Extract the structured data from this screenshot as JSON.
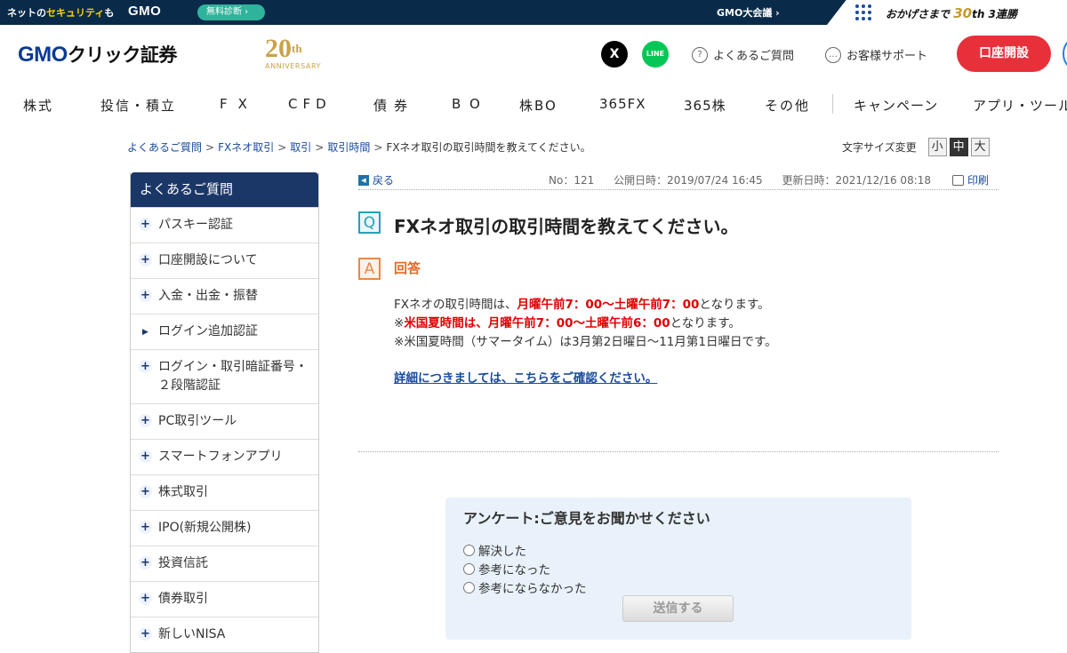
{
  "topbar": {
    "lead": "ネットの",
    "lead_highlight": "セキュリティ",
    "lead_tail": "も",
    "brand": "GMO",
    "diagnosis": "無料診断",
    "summit": "GMO大会議",
    "tagline_pre": "おかげさまで",
    "tagline_num": "30",
    "tagline_post": "th 3連勝"
  },
  "header": {
    "logo_en": "GMO",
    "logo_jp": "クリック証券",
    "anniv_num": "20",
    "anniv_sup": "th",
    "anniv_text": "ANNIVERSARY",
    "x_label": "X",
    "line_label": "LINE",
    "faq": "よくあるご質問",
    "support": "お客様サポート",
    "open_account": "口座開設"
  },
  "nav": [
    "株式",
    "投信・積立",
    "FX",
    "CFD",
    "債券",
    "BO",
    "株BO",
    "365FX",
    "365株",
    "その他",
    "キャンペーン",
    "アプリ・ツール"
  ],
  "breadcrumb": [
    "よくあるご質問",
    "FXネオ取引",
    "取引",
    "取引時間",
    "FXネオ取引の取引時間を教えてください。"
  ],
  "fontsize": {
    "label": "文字サイズ変更",
    "small": "小",
    "medium": "中",
    "large": "大",
    "selected": "中"
  },
  "sidebar": {
    "title": "よくあるご質問",
    "items": [
      {
        "label": "パスキー認証",
        "type": "plus"
      },
      {
        "label": "口座開設について",
        "type": "plus"
      },
      {
        "label": "入金・出金・振替",
        "type": "plus"
      },
      {
        "label": "ログイン追加認証",
        "type": "arrow"
      },
      {
        "label": "ログイン・取引暗証番号・２段階認証",
        "type": "plus"
      },
      {
        "label": "PC取引ツール",
        "type": "plus"
      },
      {
        "label": "スマートフォンアプリ",
        "type": "plus"
      },
      {
        "label": "株式取引",
        "type": "plus"
      },
      {
        "label": "IPO(新規公開株)",
        "type": "plus"
      },
      {
        "label": "投資信託",
        "type": "plus"
      },
      {
        "label": "債券取引",
        "type": "plus"
      },
      {
        "label": "新しいNISA",
        "type": "plus"
      }
    ]
  },
  "article": {
    "back": "戻る",
    "no": "No：121",
    "published": "公開日時：2019/07/24 16:45",
    "updated": "更新日時：2021/12/16 08:18",
    "print": "印刷",
    "q_mark": "Q",
    "question": "FXネオ取引の取引時間を教えてください。",
    "a_mark": "A",
    "answer_head": "回答",
    "line1_pre": "FXネオの取引時間は、",
    "line1_red": "月曜午前7：00〜土曜午前7：00",
    "line1_post": "となります。",
    "line2_pre": "※",
    "line2_red": "米国夏時間は、月曜午前7：00〜土曜午前6：00",
    "line2_post": "となります。",
    "line3": "※米国夏時間（サマータイム）は3月第2日曜日〜11月第1日曜日です。",
    "more_link": "詳細につきましては、こちらをご確認ください。"
  },
  "survey": {
    "title": "アンケート:ご意見をお聞かせください",
    "options": [
      "解決した",
      "参考になった",
      "参考にならなかった"
    ],
    "submit": "送信する"
  },
  "colors": {
    "navy": "#1b3768",
    "accent_red": "#e8303a",
    "answer_red": "#e00000",
    "q_teal": "#2a9fb5",
    "a_orange": "#e58a4a"
  }
}
